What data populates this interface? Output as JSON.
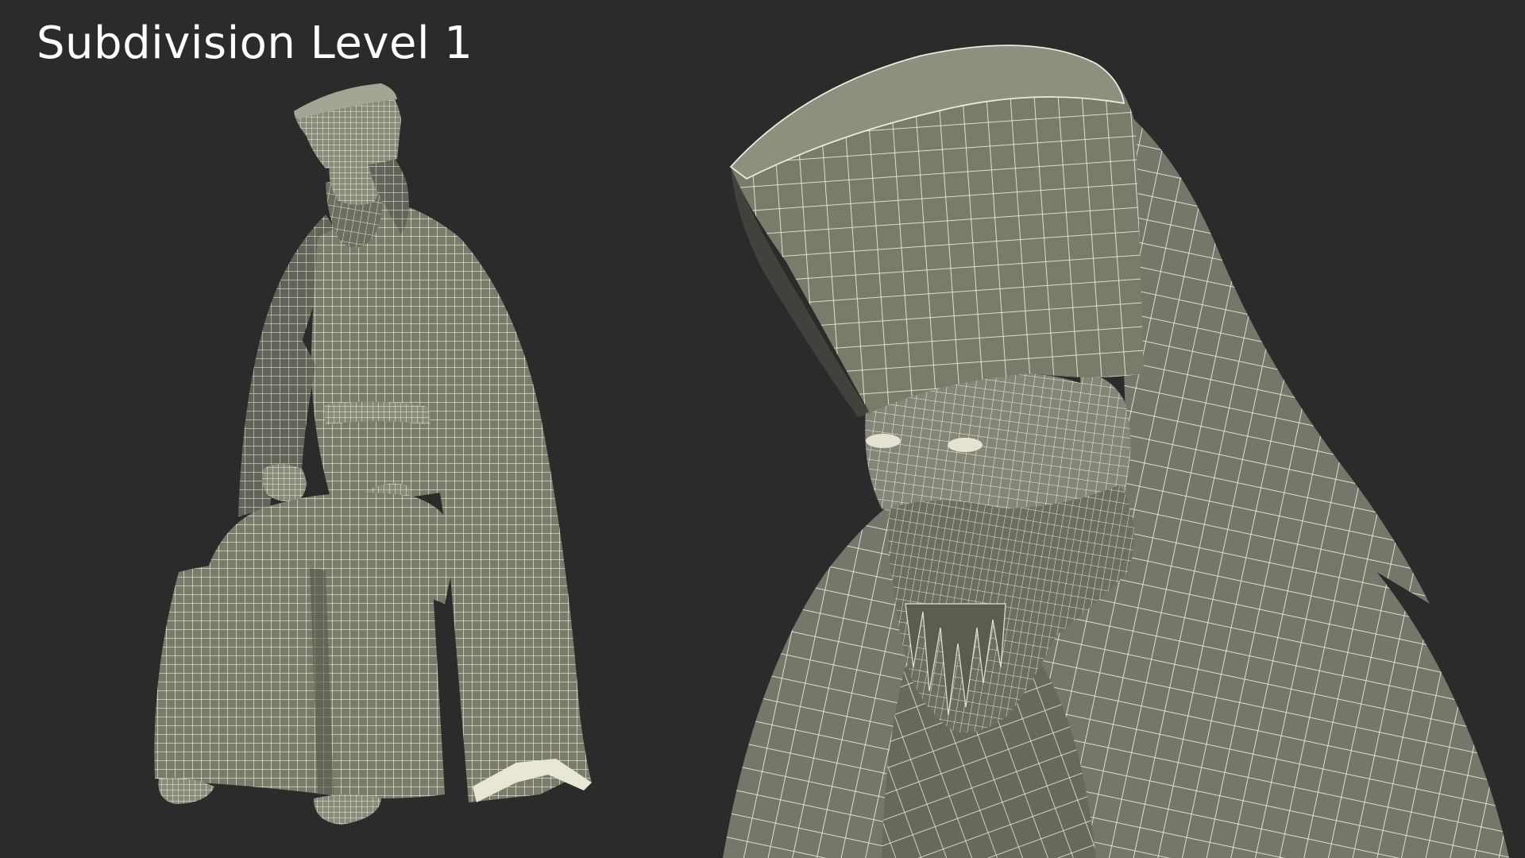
{
  "title": "Subdivision Level 1",
  "colors": {
    "background": "#2b2b2b",
    "mesh_fill": "#7b7b6c",
    "mesh_fill_shadow": "#5f5f53",
    "wire": "#ecebd9",
    "title_text": "#ffffff"
  },
  "views": [
    {
      "name": "full-body-wireframe-view"
    },
    {
      "name": "closeup-head-wireframe-view"
    }
  ]
}
